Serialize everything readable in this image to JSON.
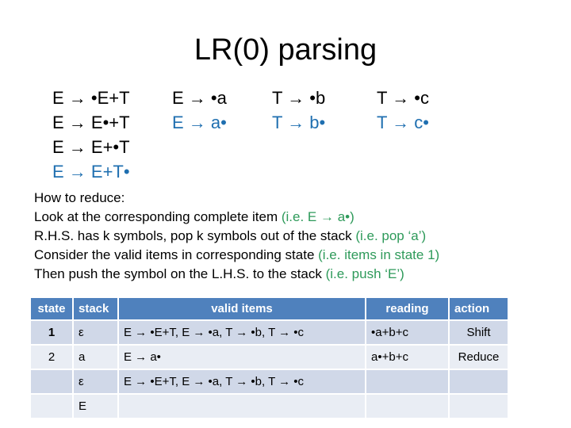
{
  "title": "LR(0) parsing",
  "grammar_columns": [
    {
      "items": [
        {
          "text": "E → •E+T",
          "complete": false
        },
        {
          "text": "E → E•+T",
          "complete": false
        },
        {
          "text": "E → E+•T",
          "complete": false
        },
        {
          "text": "E → E+T•",
          "complete": true
        }
      ]
    },
    {
      "items": [
        {
          "text": "E → •a",
          "complete": false
        },
        {
          "text": "E → a•",
          "complete": true
        }
      ]
    },
    {
      "items": [
        {
          "text": "T → •b",
          "complete": false
        },
        {
          "text": "T → b•",
          "complete": true
        }
      ]
    },
    {
      "items": [
        {
          "text": "T → •c",
          "complete": false
        },
        {
          "text": "T → c•",
          "complete": true
        }
      ]
    }
  ],
  "notes": {
    "heading": "How to reduce:",
    "lines": [
      {
        "text": "Look at the corresponding complete item ",
        "example": "(i.e. E → a•)"
      },
      {
        "text": "R.H.S. has k symbols, pop k symbols out  of the stack ",
        "example": "(i.e. pop ‘a’)"
      },
      {
        "text": "Consider the valid items in corresponding state ",
        "example": "(i.e. items in state 1)"
      },
      {
        "text": "Then push the symbol on the L.H.S. to the stack ",
        "example": "(i.e. push ‘E’)"
      }
    ]
  },
  "table": {
    "headers": [
      "state",
      "stack",
      "valid items",
      "reading",
      "action"
    ],
    "rows": [
      [
        "1",
        "ε",
        "E → •E+T, E → •a, T → •b, T → •c",
        "•a+b+c",
        "Shift"
      ],
      [
        "2",
        "a",
        "E → a•",
        "a•+b+c",
        "Reduce"
      ],
      [
        "",
        "ε",
        "E → •E+T, E → •a, T → •b, T → •c",
        "",
        ""
      ],
      [
        "",
        "E",
        "",
        "",
        ""
      ]
    ]
  },
  "colors": {
    "complete_item": "#1f6fb0",
    "example": "#2e9a5a",
    "header_bg": "#4f81bd",
    "row_odd": "#d0d8e8",
    "row_even": "#e9edf4"
  }
}
